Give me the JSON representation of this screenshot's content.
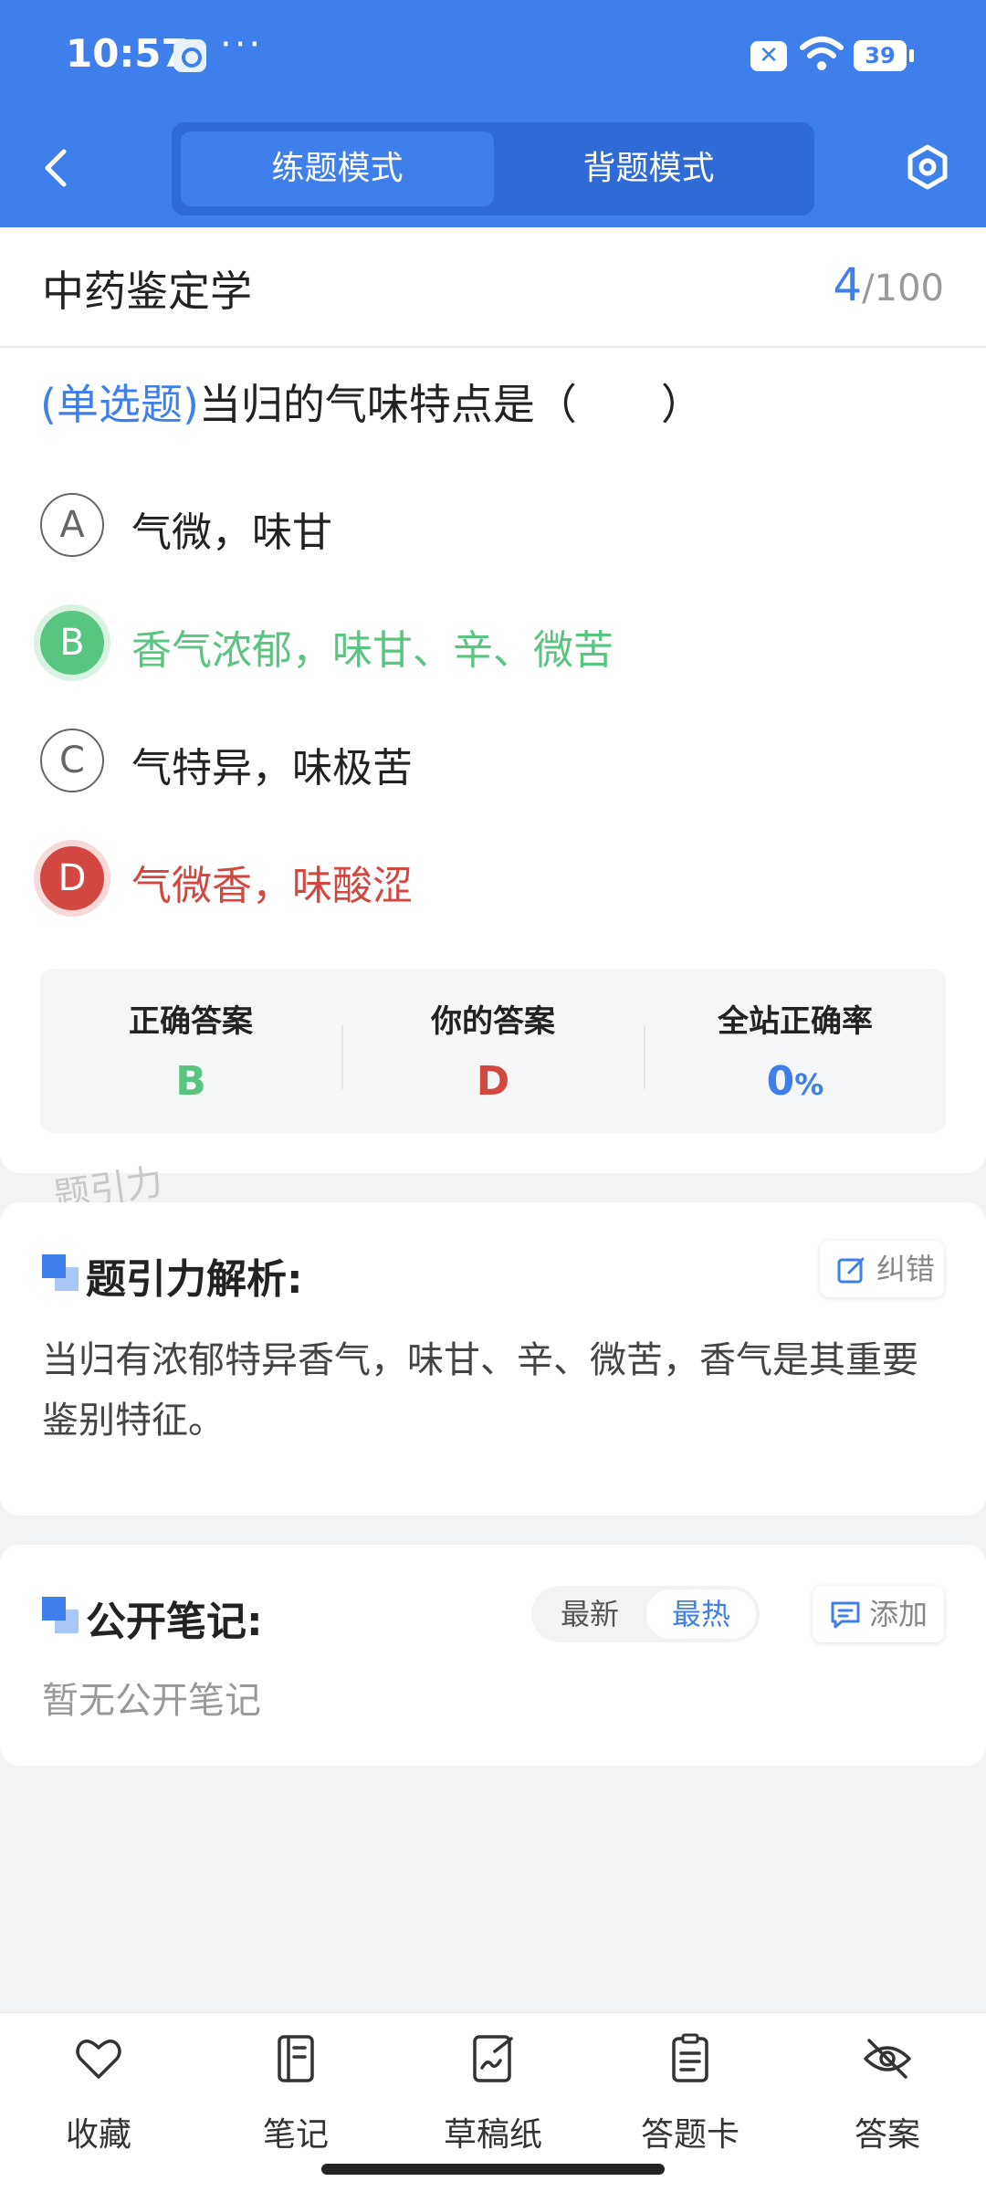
{
  "status_bar": {
    "time": "10:57",
    "dots": "···",
    "battery": "39"
  },
  "header": {
    "modes": [
      "练题模式",
      "背题模式"
    ],
    "active_mode": "练题模式"
  },
  "question": {
    "subject": "中药鉴定学",
    "current": "4",
    "total": "/100",
    "type": "(单选题)",
    "text": "当归的气味特点是（　　）",
    "options": [
      {
        "letter": "A",
        "text": "气微，味甘",
        "state": "normal"
      },
      {
        "letter": "B",
        "text": "香气浓郁，味甘、辛、微苦",
        "state": "correct"
      },
      {
        "letter": "C",
        "text": "气特异，味极苦",
        "state": "normal"
      },
      {
        "letter": "D",
        "text": "气微香，味酸涩",
        "state": "wrong"
      }
    ],
    "answer_summary": {
      "correct_label": "正确答案",
      "correct_value": "B",
      "yours_label": "你的答案",
      "yours_value": "D",
      "rate_label": "全站正确率",
      "rate_value": "0",
      "rate_unit": "%"
    },
    "watermark": "题引力"
  },
  "analysis": {
    "title": "题引力解析:",
    "correct_btn": "纠错",
    "text": "当归有浓郁特异香气，味甘、辛、微苦，香气是其重要鉴别特征。"
  },
  "notes": {
    "title": "公开笔记:",
    "sort_options": [
      "最新",
      "最热"
    ],
    "active_sort": "最热",
    "add_btn": "添加",
    "empty_text": "暂无公开笔记"
  },
  "bottom_nav": [
    {
      "label": "收藏",
      "icon": "heart-icon"
    },
    {
      "label": "笔记",
      "icon": "notebook-icon"
    },
    {
      "label": "草稿纸",
      "icon": "draft-icon"
    },
    {
      "label": "答题卡",
      "icon": "answer-card-icon"
    },
    {
      "label": "答案",
      "icon": "eye-off-icon"
    }
  ],
  "colors": {
    "primary": "#3f7fec",
    "correct": "#58c581",
    "wrong": "#d2473f"
  }
}
